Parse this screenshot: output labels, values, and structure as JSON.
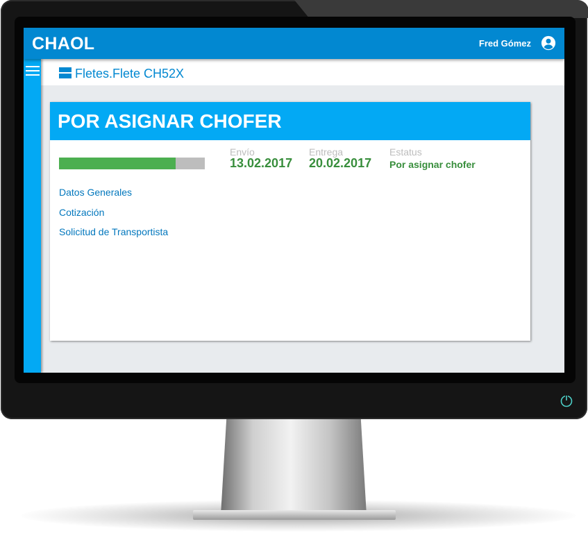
{
  "app": {
    "title": "CHAOL"
  },
  "user": {
    "name": "Fred Gómez",
    "icon": "account-circle-icon"
  },
  "breadcrumb": {
    "text": "Fletes.Flete CH52X"
  },
  "card": {
    "title": "POR ASIGNAR CHOFER",
    "progress": 0.8,
    "envio": {
      "label": "Envío",
      "value": "13.02.2017"
    },
    "entrega": {
      "label": "Entrega",
      "value": "20.02.2017"
    },
    "estatus": {
      "label": "Estatus",
      "value": "Por asignar chofer"
    },
    "links": [
      "Datos Generales",
      "Cotización",
      "Solicitud de Transportista"
    ]
  },
  "colors": {
    "appbar": "#0288d1",
    "accent": "#03a9f4",
    "progress_fill": "#4caf50",
    "status_text": "#388e3c",
    "link": "#0277bd"
  }
}
